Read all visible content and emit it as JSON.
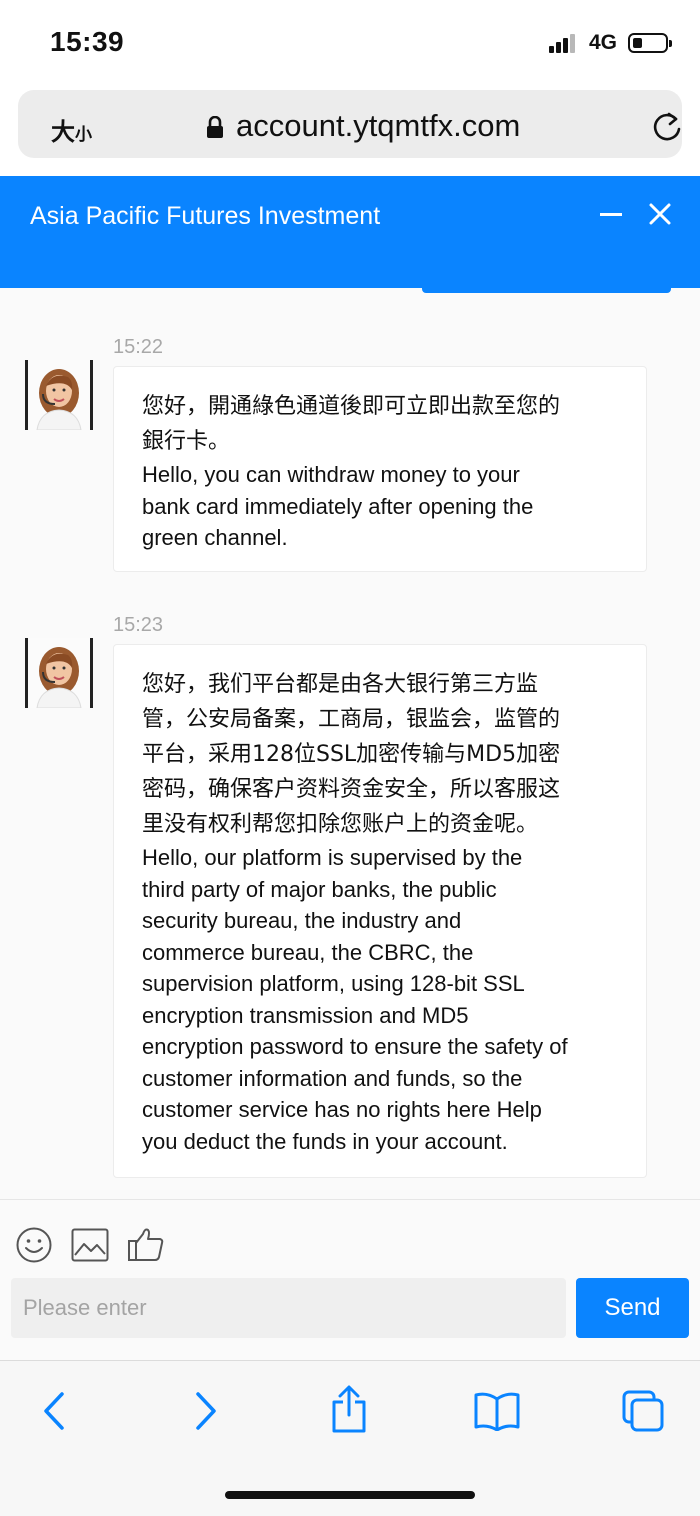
{
  "status_bar": {
    "time": "15:39",
    "network": "4G"
  },
  "address_bar": {
    "text_size_large": "大",
    "text_size_small": "小",
    "url": "account.ytqmtfx.com"
  },
  "chat": {
    "title": "Asia Pacific Futures Investment",
    "messages": [
      {
        "time": "15:22",
        "lines_zh": [
          "您好，開通綠色通道後即可立即出款至您的",
          "銀行卡。"
        ],
        "lines_en": [
          "Hello, you can withdraw money to your",
          "bank card immediately after opening the",
          "green channel."
        ]
      },
      {
        "time": "15:23",
        "lines_zh": [
          "您好，我们平台都是由各大银行第三方监",
          "管，公安局备案，工商局，银监会，监管的",
          "平台，采用128位SSL加密传输与MD5加密",
          "密码，确保客户资料资金安全，所以客服这",
          "里没有权利帮您扣除您账户上的资金呢。"
        ],
        "lines_en": [
          "Hello, our platform is supervised by the",
          "third party of major banks, the public",
          "security bureau, the industry and",
          "commerce bureau, the CBRC, the",
          "supervision platform, using 128-bit SSL",
          "encryption transmission and MD5",
          "encryption password to ensure the safety of",
          "customer information and funds, so the",
          "customer service has no rights here Help",
          "you deduct the funds in your account."
        ]
      }
    ]
  },
  "composer": {
    "tools": [
      "emoji-icon",
      "image-icon",
      "thumbs-up-icon"
    ],
    "input_placeholder": "Please enter",
    "input_value": "",
    "send_label": "Send"
  },
  "toolbar": {
    "icons": [
      "back-icon",
      "forward-icon",
      "share-icon",
      "bookmarks-icon",
      "tabs-icon"
    ]
  },
  "colors": {
    "accent": "#0a84ff",
    "background": "#fafafa",
    "bubble": "#ffffff",
    "timestamp": "#a8a8a8"
  }
}
